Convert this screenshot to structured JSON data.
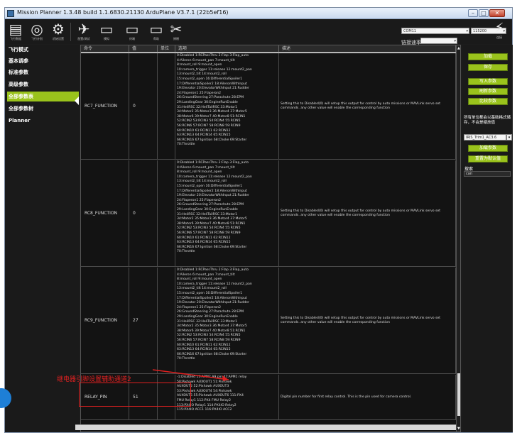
{
  "window": {
    "title": "Mission Planner 1.3.48 build 1.1.6830.21130 ArduPlane V3.7.1 (22b5ef16)",
    "controls": {
      "min": "–",
      "max": "□",
      "close": "✕"
    }
  },
  "toolbar": {
    "items": [
      {
        "label": "飞行数据",
        "icon": "flight-data-icon",
        "glyph": "▤"
      },
      {
        "label": "飞行计划",
        "icon": "flight-plan-icon",
        "glyph": "◎"
      },
      {
        "label": "初始设置",
        "icon": "initial-setup-icon",
        "glyph": "⚙"
      },
      {
        "label": "配置/调试",
        "icon": "config-tuning-icon",
        "glyph": "✈"
      },
      {
        "label": "模拟",
        "icon": "simulation-icon",
        "glyph": "▭"
      },
      {
        "label": "终端",
        "icon": "terminal-icon",
        "glyph": "▭"
      },
      {
        "label": "帮助",
        "icon": "help-icon",
        "glyph": "▭"
      },
      {
        "label": "捐赠",
        "icon": "donate-icon",
        "glyph": "✂"
      }
    ],
    "port": "COM11",
    "baud": "115200",
    "rate_label": "链接速率",
    "connect_label": "连接",
    "connect_glyph": "⚡"
  },
  "sidebar": {
    "items": [
      {
        "label": "飞行模式",
        "active": false
      },
      {
        "label": "基本调参",
        "active": false
      },
      {
        "label": "标准参数",
        "active": false
      },
      {
        "label": "高级参数",
        "active": false
      },
      {
        "label": "全部参数表",
        "active": true
      },
      {
        "label": "全部参数树",
        "active": false
      },
      {
        "label": "Planner",
        "active": false
      }
    ]
  },
  "grid": {
    "headers": [
      "命令",
      "值",
      "单位",
      "选项",
      "描述"
    ],
    "rows": [
      {
        "name": "RC7_FUNCTION",
        "value": "0",
        "units": "",
        "options": "0:Disabled 1:RCPassThru 2:Flap 3:Flap_auto\n4:Aileron 6:mount_pan 7:mount_tilt\n8:mount_roll 9:mount_open\n10:camera_trigger 11:release 12:mount2_pan\n13:mount2_tilt 14:mount2_roll\n15:mount2_open 16:DifferentialSpoiler1\n17:DifferentialSpoiler2 18:AileronWithInput\n19:Elevator 20:ElevatorWithInput 21:Rudder\n24:Flaperon1 25:Flaperon2\n26:GroundSteering 27:Parachute 28:EPM\n29:LandingGear 30:EngineRunEnable\n31:HeliRSC 32:HeliTailRSC 33:Motor1\n34:Motor2 35:Motor3 36:Motor4 37:Motor5\n38:Motor6 39:Motor7 40:Motor8 51:RCIN1\n52:RCIN2 53:RCIN3 54:RCIN4 55:RCIN5\n56:RCIN6 57:RCIN7 58:RCIN8 59:RCIN9\n60:RCIN10 61:RCIN11 62:RCIN12\n63:RCIN13 64:RCIN14 65:RCIN15\n66:RCIN16 67:Ignition 68:Choke 69:Starter\n70:Throttle",
        "description": "Setting this to Disabled(0) will setup this output for control by auto missions or MAVLink servo set commands. any other value will enable the corresponding function"
      },
      {
        "name": "RC8_FUNCTION",
        "value": "0",
        "units": "",
        "options": "0:Disabled 1:RCPassThru 2:Flap 3:Flap_auto\n4:Aileron 6:mount_pan 7:mount_tilt\n8:mount_roll 9:mount_open\n10:camera_trigger 11:release 12:mount2_pan\n13:mount2_tilt 14:mount2_roll\n15:mount2_open 16:DifferentialSpoiler1\n17:DifferentialSpoiler2 18:AileronWithInput\n19:Elevator 20:ElevatorWithInput 21:Rudder\n24:Flaperon1 25:Flaperon2\n26:GroundSteering 27:Parachute 28:EPM\n29:LandingGear 30:EngineRunEnable\n31:HeliRSC 32:HeliTailRSC 33:Motor1\n34:Motor2 35:Motor3 36:Motor4 37:Motor5\n38:Motor6 39:Motor7 40:Motor8 51:RCIN1\n52:RCIN2 53:RCIN3 54:RCIN4 55:RCIN5\n56:RCIN6 57:RCIN7 58:RCIN8 59:RCIN9\n60:RCIN10 61:RCIN11 62:RCIN12\n63:RCIN13 64:RCIN14 65:RCIN15\n66:RCIN16 67:Ignition 68:Choke 69:Starter\n70:Throttle",
        "description": "Setting this to Disabled(0) will setup this output for control by auto missions or MAVLink servo set commands. any other value will enable the corresponding function"
      },
      {
        "name": "RC9_FUNCTION",
        "value": "27",
        "units": "",
        "options": "0:Disabled 1:RCPassThru 2:Flap 3:Flap_auto\n4:Aileron 6:mount_pan 7:mount_tilt\n8:mount_roll 9:mount_open\n10:camera_trigger 11:release 12:mount2_pan\n13:mount2_tilt 14:mount2_roll\n15:mount2_open 16:DifferentialSpoiler1\n17:DifferentialSpoiler2 18:AileronWithInput\n19:Elevator 20:ElevatorWithInput 21:Rudder\n24:Flaperon1 25:Flaperon2\n26:GroundSteering 27:Parachute 28:EPM\n29:LandingGear 30:EngineRunEnable\n31:HeliRSC 32:HeliTailRSC 33:Motor1\n34:Motor2 35:Motor3 36:Motor4 37:Motor5\n38:Motor6 39:Motor7 40:Motor8 51:RCIN1\n52:RCIN2 53:RCIN3 54:RCIN4 55:RCIN5\n56:RCIN6 57:RCIN7 58:RCIN8 59:RCIN9\n60:RCIN10 61:RCIN11 62:RCIN12\n63:RCIN13 64:RCIN14 65:RCIN15\n66:RCIN16 67:Ignition 68:Choke 69:Starter\n70:Throttle",
        "description": "Setting this to Disabled(0) will setup this output for control by auto missions or MAVLink servo set commands. any other value will enable the corresponding function"
      },
      {
        "name": "RELAY_PIN",
        "value": "51",
        "units": "",
        "options": "-1:Disabled 13:APM2 A9 pin 47:APM1 relay\n50:Pixhawk AUXOUT1 51:Pixhawk\nAUXOUT2 52:Pixhawk AUXOUT3\n53:Pixhawk AUXOUT4 54:Pixhawk\nAUXOUT5 55:Pixhawk AUXOUT6 111:PX4\nFMU Relay1 112:PX4 FMU Relay2\n113:PX4IO Relay1 114:PX4IO Relay2\n115:PX4IO ACC1 116:PX4IO ACC2",
        "description": "Digital pin number for first relay control. This is the pin used for camera control."
      }
    ]
  },
  "right_panel": {
    "buttons": [
      "加载",
      "保存",
      "写入参数",
      "刷新参数",
      "比较参数"
    ],
    "note": "所有单位都会以基础格式储存，不会是缩放值",
    "dropdown": "IRIS_Trim1_AC3.6",
    "buttons2": [
      "加载参数",
      "重置为默认值"
    ],
    "search_label": "搜索",
    "search_value": "can"
  },
  "annotation": {
    "text": "继电器引脚设置辅助通道2",
    "color": "#e02020"
  }
}
